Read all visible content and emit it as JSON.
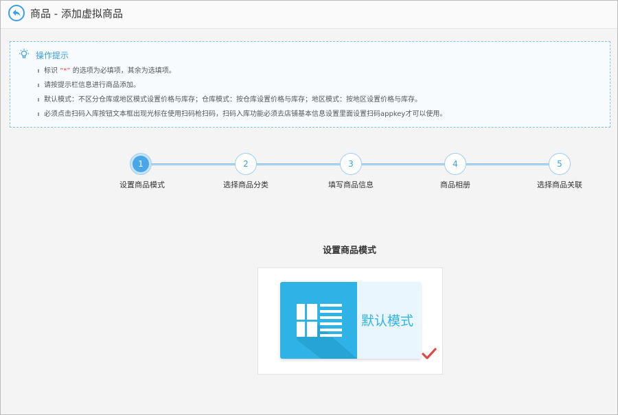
{
  "header": {
    "title": "商品 - 添加虚拟商品",
    "back_icon": "back-arrow-icon"
  },
  "tips": {
    "title": "操作提示",
    "icon": "lightbulb-icon",
    "items": [
      {
        "prefix": "标识 ",
        "star": "“*”",
        "suffix": " 的选项为必填项，其余为选填项。"
      },
      {
        "prefix": "请按提示栏信息进行商品添加。",
        "star": "",
        "suffix": ""
      },
      {
        "prefix": "默认模式：不区分仓库或地区模式设置价格与库存；仓库模式：按仓库设置价格与库存；地区模式：按地区设置价格与库存。",
        "star": "",
        "suffix": ""
      },
      {
        "prefix": "必须点击扫码入库按钮文本框出现光标在使用扫码枪扫码，扫码入库功能必须去店铺基本信息设置里面设置扫码appkey才可以使用。",
        "star": "",
        "suffix": ""
      }
    ]
  },
  "steps": [
    {
      "num": "1",
      "label": "设置商品模式",
      "active": true
    },
    {
      "num": "2",
      "label": "选择商品分类",
      "active": false
    },
    {
      "num": "3",
      "label": "填写商品信息",
      "active": false
    },
    {
      "num": "4",
      "label": "商品相册",
      "active": false
    },
    {
      "num": "5",
      "label": "选择商品关联",
      "active": false
    }
  ],
  "mode_section": {
    "title": "设置商品模式",
    "card": {
      "label": "默认模式",
      "icon": "list-layout-icon",
      "selected": true
    },
    "check_icon": "checkmark-icon"
  },
  "colors": {
    "accent": "#3b9fe0",
    "card_blue": "#2fb3e6",
    "check_red": "#e64545"
  }
}
